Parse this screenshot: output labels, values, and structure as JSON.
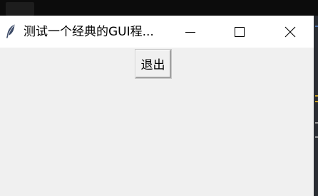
{
  "window": {
    "title": "测试一个经典的GUI程...",
    "icon": "feather-icon",
    "controls": {
      "minimize_icon": "minimize-icon",
      "maximize_icon": "maximize-icon",
      "close_icon": "close-icon"
    }
  },
  "main": {
    "quit_label": "退出"
  },
  "colors": {
    "titlebar": "#ffffff",
    "client_background": "#f0f0f0",
    "desktop": "#000000",
    "side_panel": "#2a2d33"
  }
}
